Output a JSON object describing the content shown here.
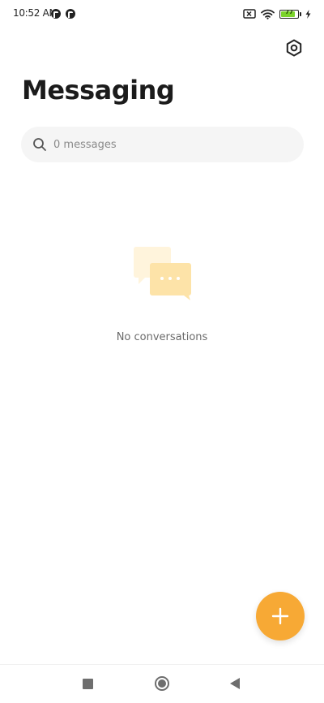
{
  "status_bar": {
    "time": "10:52 AM",
    "battery_level": "77",
    "icons": [
      "app-notification-icon",
      "app-notification-icon",
      "no-sim-icon",
      "wifi-icon",
      "battery-icon",
      "charging-icon"
    ]
  },
  "header": {
    "title": "Messaging",
    "settings_icon": "hexagon-settings-icon"
  },
  "search": {
    "placeholder": "0 messages",
    "value": ""
  },
  "empty_state": {
    "icon": "chat-bubbles-icon",
    "text": "No conversations"
  },
  "fab": {
    "icon": "plus-icon"
  },
  "navigation": {
    "items": [
      "recents-icon",
      "home-icon",
      "back-icon"
    ]
  },
  "colors": {
    "accent": "#f7a935",
    "battery": "#7bd32b",
    "search_bg": "#f5f5f5",
    "illustration": "#fde3a8"
  }
}
